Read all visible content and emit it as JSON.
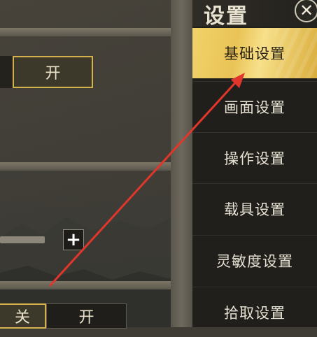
{
  "settings_panel": {
    "title": "设置",
    "close_glyph": "✕",
    "menu": [
      {
        "label": "基础设置",
        "active": true
      },
      {
        "label": "画面设置",
        "active": false
      },
      {
        "label": "操作设置",
        "active": false
      },
      {
        "label": "载具设置",
        "active": false
      },
      {
        "label": "灵敏度设置",
        "active": false
      },
      {
        "label": "拾取设置",
        "active": false
      }
    ]
  },
  "content": {
    "toggle_top_on": "开",
    "plus": "+",
    "toggle_bottom_off": "关",
    "toggle_bottom_on": "开"
  },
  "colors": {
    "accent_gold": "#d3b24e",
    "arrow_red": "#e0362b"
  }
}
